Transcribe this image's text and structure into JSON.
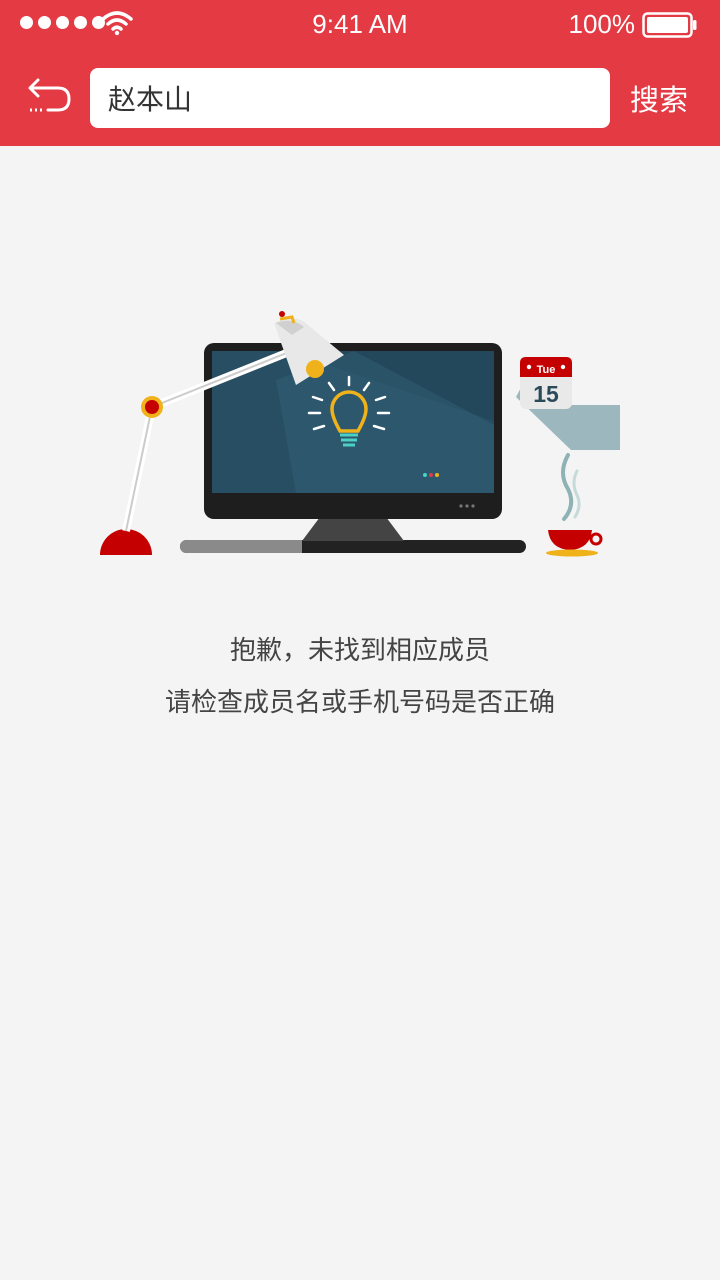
{
  "status_bar": {
    "time": "9:41 AM",
    "battery_percent": "100%",
    "battery_level": 1.0,
    "signal_bars": 5
  },
  "header": {
    "back_icon": "back-arrow-icon",
    "search_value": "赵本山",
    "search_button_label": "搜索",
    "accent_color": "#e43a44"
  },
  "illustration": {
    "icon": "desk-lamp-computer-illustration",
    "calendar_day": "Tue",
    "calendar_date": "15"
  },
  "empty_state": {
    "line1": "抱歉，未找到相应成员",
    "line2": "请检查成员名或手机号码是否正确"
  }
}
